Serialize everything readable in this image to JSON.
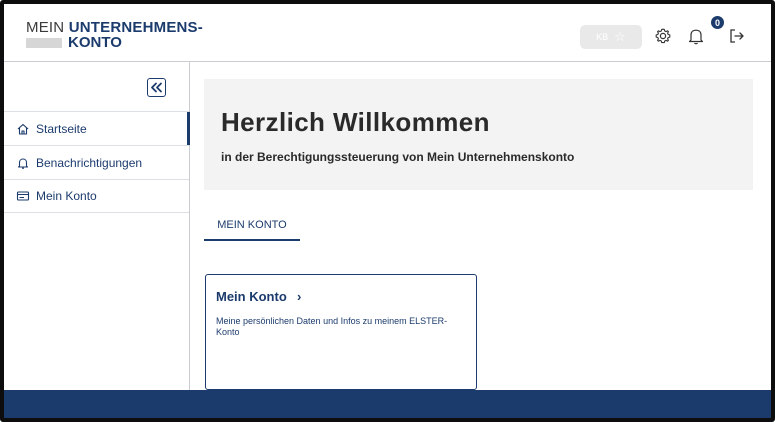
{
  "logo": {
    "line1_prefix": "MEIN",
    "line1_bold": "UNTERNEHMENS-",
    "line2_bold": "KONTO"
  },
  "header": {
    "kb_label": "KB",
    "notification_count": "0"
  },
  "sidebar": {
    "items": [
      {
        "label": "Startseite",
        "icon": "home-icon",
        "active": true
      },
      {
        "label": "Benachrichtigungen",
        "icon": "bell-icon",
        "active": false
      },
      {
        "label": "Mein Konto",
        "icon": "id-card-icon",
        "active": false
      }
    ]
  },
  "hero": {
    "title": "Herzlich Willkommen",
    "subtitle": "in der Berechtigungssteuerung von Mein Unternehmenskonto"
  },
  "tabs": [
    {
      "label": "MEIN KONTO"
    }
  ],
  "card": {
    "title": "Mein Konto",
    "chevron": "›",
    "description": "Meine persönlichen Daten und Infos zu meinem ELSTER-Konto"
  },
  "colors": {
    "brand": "#1c3b6d",
    "hero_bg": "#f3f3f4",
    "footer": "#1c3b6d"
  }
}
